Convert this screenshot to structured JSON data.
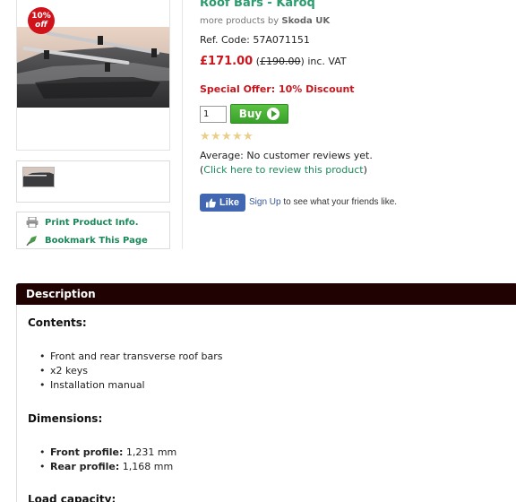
{
  "product": {
    "title": "Roof Bars - Karoq",
    "more_products_prefix": "more products by ",
    "brand": "Skoda UK",
    "ref_code": "Ref. Code: 57A071151",
    "price_now": "£171.00",
    "price_was": "£190.00",
    "price_suffix": "inc. VAT",
    "special_offer": "Special Offer: 10% Discount",
    "badge_pct": "10%",
    "badge_off": "off"
  },
  "purchase": {
    "quantity": "1",
    "buy_label": "Buy"
  },
  "reviews": {
    "average": "Average: No customer reviews yet.",
    "review_link": "Click here to review this product",
    "stars_filled": 0,
    "stars_total": 5
  },
  "tools": {
    "print_label": "Print Product Info.",
    "bookmark_label": "Bookmark This Page"
  },
  "facebook": {
    "like_label": "Like",
    "signup_label": "Sign Up",
    "signup_suffix": " to see what your friends like."
  },
  "description": {
    "header": "Description",
    "contents_heading": "Contents:",
    "contents_items": [
      "Front and rear transverse roof bars",
      "x2 keys",
      "Installation manual"
    ],
    "dimensions_heading": "Dimensions:",
    "dimensions_items": [
      {
        "label": "Front profile:",
        "value": " 1,231 mm"
      },
      {
        "label": "Rear profile:",
        "value": " 1,168 mm"
      }
    ],
    "load_heading": "Load capacity:"
  },
  "colors": {
    "title_green": "#2a9c6e",
    "price_red": "#c8161d",
    "buy_green": "#38a02a",
    "header_dark": "#200203",
    "facebook_blue": "#4267b2"
  }
}
